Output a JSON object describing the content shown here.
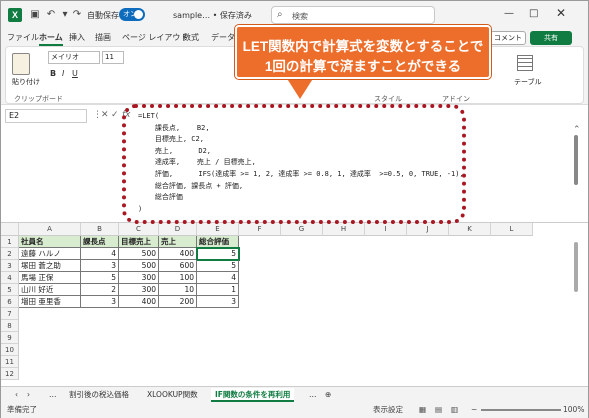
{
  "titlebar": {
    "logo": "X",
    "autosave_label": "自動保存",
    "toggle_state": "オン",
    "doc_title": "sample… • 保存済み",
    "search_placeholder": "検索",
    "user": "ユーザー"
  },
  "menu": {
    "tabs": [
      "ファイル",
      "ホーム",
      "挿入",
      "描画",
      "ページ レイアウト",
      "数式",
      "データ",
      "校閲",
      "表示",
      "開発",
      "ヘルプ"
    ],
    "comment": "コメント",
    "share": "共有"
  },
  "ribbon": {
    "paste": "貼り付け",
    "font": "メイリオ",
    "size": "11",
    "clipboard": "クリップボード",
    "style": "スタイル",
    "addin": "アドイン",
    "table": "テーブル"
  },
  "formula_bar": {
    "namebox": "E2",
    "fx": "fx",
    "lines": [
      "=LET(",
      "    課長点,    B2,",
      "    目標売上, C2,",
      "    売上,      D2,",
      "    達成率,    売上 / 目標売上,",
      "    評価,      IFS(達成率 >= 1, 2, 達成率 >= 0.8, 1, 達成率  >=0.5, 0, TRUE, -1),",
      "    総合評価, 課長点 + 評価,",
      "    総合評価",
      ")"
    ]
  },
  "callout": {
    "line1": "LET関数内で計算式を変数とすることで",
    "line2": "1回の計算で済ますことができる"
  },
  "grid": {
    "columns": [
      "A",
      "B",
      "C",
      "D",
      "E",
      "F",
      "G",
      "H",
      "I",
      "J",
      "K",
      "L"
    ],
    "rows": [
      "1",
      "2",
      "3",
      "4",
      "5",
      "6",
      "7",
      "8",
      "9",
      "10",
      "11",
      "12"
    ],
    "headers": [
      "社員名",
      "課長点",
      "目標売上",
      "売上",
      "総合評価"
    ],
    "data": [
      [
        "遠藤 ハルノ",
        "4",
        "500",
        "400",
        "5"
      ],
      [
        "塚田 蒼之助",
        "3",
        "500",
        "600",
        "5"
      ],
      [
        "馬場 正保",
        "5",
        "300",
        "100",
        "4"
      ],
      [
        "山川 好近",
        "2",
        "300",
        "10",
        "1"
      ],
      [
        "増田 亜里香",
        "3",
        "400",
        "200",
        "3"
      ]
    ]
  },
  "sheets": {
    "tabs": [
      "割引後の税込価格",
      "XLOOKUP関数",
      "IF関数の条件を再利用"
    ],
    "active": 2
  },
  "status": {
    "ready": "準備完了",
    "display": "表示設定",
    "zoom": "100%"
  }
}
